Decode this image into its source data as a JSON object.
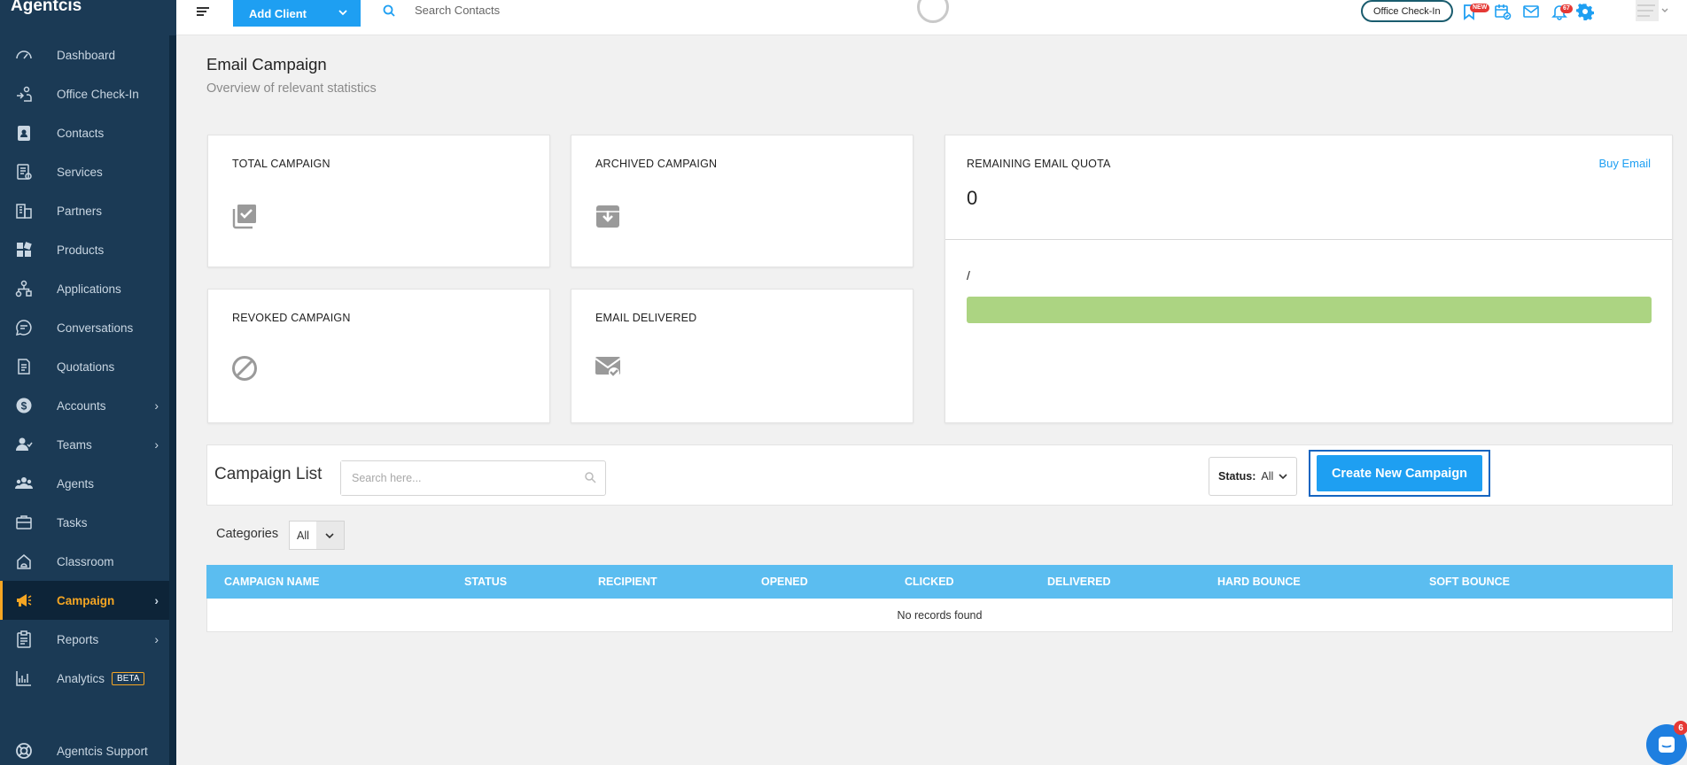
{
  "app": {
    "brand": "Agentcis"
  },
  "sidebar": {
    "items": [
      {
        "label": "Dashboard",
        "icon": "dashboard-icon"
      },
      {
        "label": "Office Check-In",
        "icon": "checkin-icon"
      },
      {
        "label": "Contacts",
        "icon": "contacts-icon"
      },
      {
        "label": "Services",
        "icon": "services-icon"
      },
      {
        "label": "Partners",
        "icon": "partners-icon"
      },
      {
        "label": "Products",
        "icon": "products-icon"
      },
      {
        "label": "Applications",
        "icon": "applications-icon"
      },
      {
        "label": "Conversations",
        "icon": "conversations-icon"
      },
      {
        "label": "Quotations",
        "icon": "quotations-icon"
      },
      {
        "label": "Accounts",
        "icon": "accounts-icon"
      },
      {
        "label": "Teams",
        "icon": "teams-icon"
      },
      {
        "label": "Agents",
        "icon": "agents-icon"
      },
      {
        "label": "Tasks",
        "icon": "tasks-icon"
      },
      {
        "label": "Classroom",
        "icon": "classroom-icon"
      },
      {
        "label": "Campaign",
        "icon": "campaign-icon"
      },
      {
        "label": "Reports",
        "icon": "reports-icon"
      },
      {
        "label": "Analytics",
        "icon": "analytics-icon",
        "badge": "BETA"
      }
    ],
    "support": "Agentcis Support"
  },
  "topbar": {
    "add_client": "Add Client",
    "search_placeholder": "Search Contacts",
    "office_checkin": "Office Check-In",
    "new_badge": "NEW",
    "notif_count": "67"
  },
  "page": {
    "title": "Email Campaign",
    "subtitle": "Overview of relevant statistics"
  },
  "stats": {
    "total": "TOTAL CAMPAIGN",
    "archived": "ARCHIVED CAMPAIGN",
    "revoked": "REVOKED CAMPAIGN",
    "delivered": "EMAIL DELIVERED"
  },
  "quota": {
    "label": "REMAINING EMAIL QUOTA",
    "buy": "Buy Email",
    "value": "0",
    "ratio": "/",
    "progress": 1.0
  },
  "campaign_list": {
    "title": "Campaign List",
    "search_placeholder": "Search here...",
    "status_label": "Status:",
    "status_value": "All",
    "create_button": "Create New Campaign",
    "categories_label": "Categories",
    "categories_value": "All",
    "columns": [
      "CAMPAIGN NAME",
      "STATUS",
      "RECIPIENT",
      "OPENED",
      "CLICKED",
      "DELIVERED",
      "HARD BOUNCE",
      "SOFT BOUNCE"
    ],
    "empty_text": "No records found"
  },
  "chat": {
    "badge": "6"
  },
  "colors": {
    "sidebar": "#1b3a55",
    "accent": "#1e9ff2",
    "active": "#f5a623",
    "progress": "#acd482",
    "table_header": "#5bbdf0"
  }
}
